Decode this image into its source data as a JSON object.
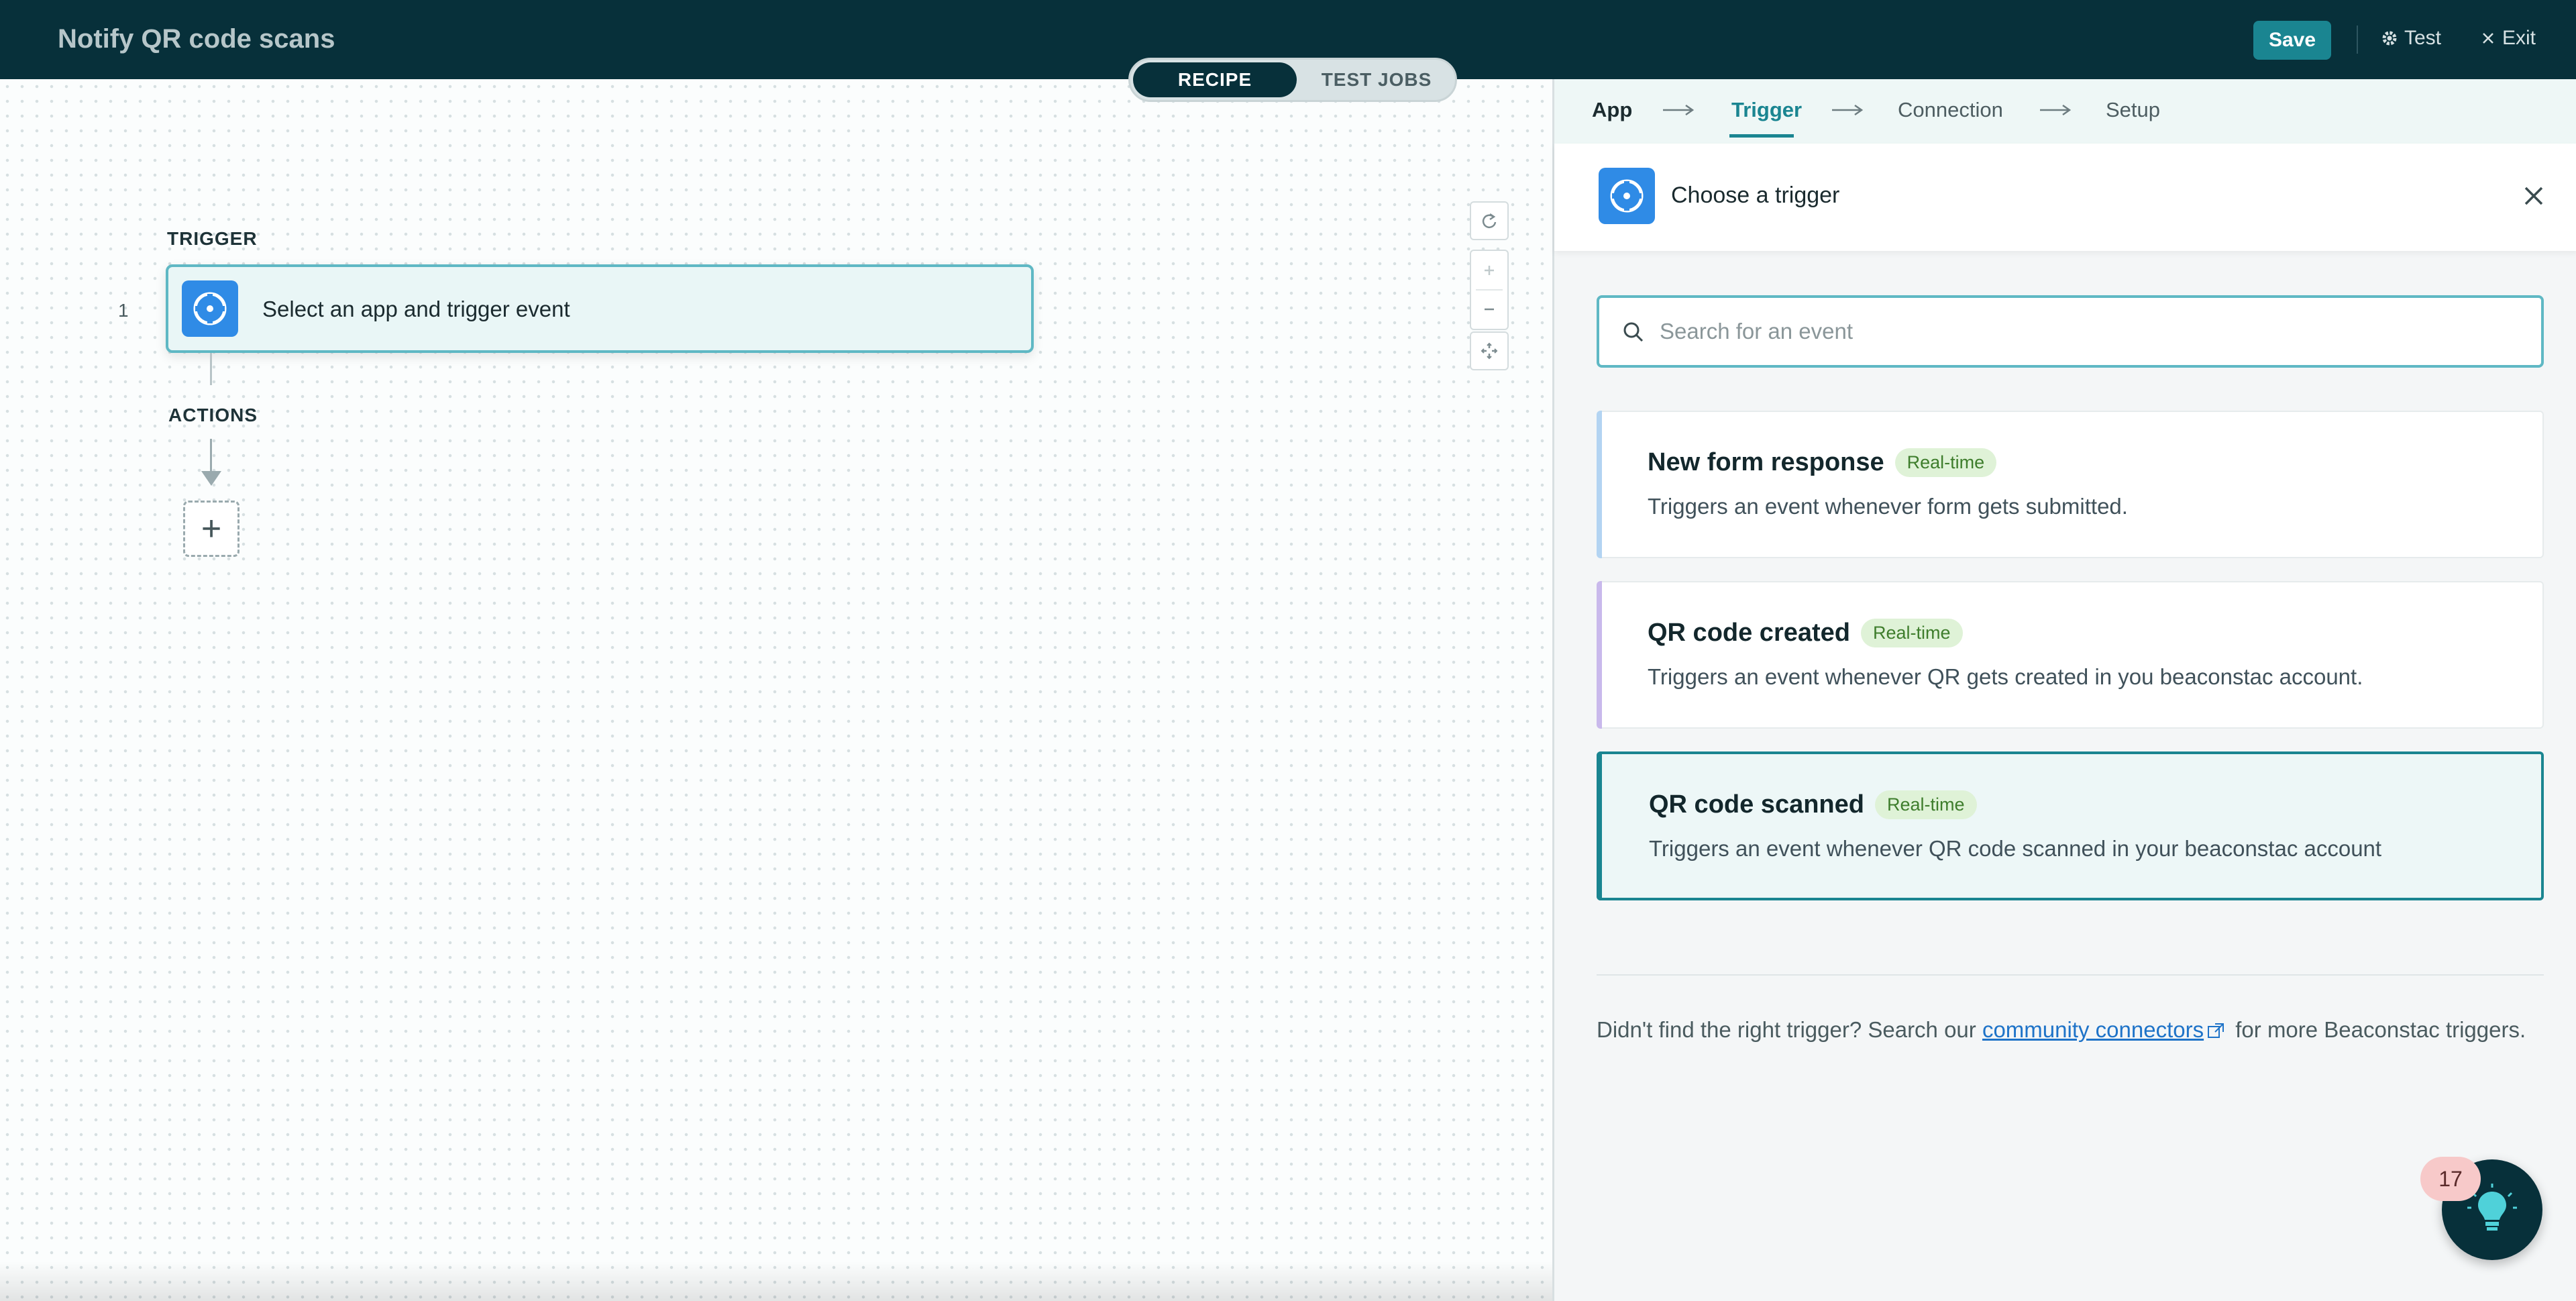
{
  "header": {
    "title": "Notify QR code scans",
    "save_label": "Save",
    "test_label": "Test",
    "exit_label": "Exit"
  },
  "mode_toggle": {
    "options": [
      "RECIPE",
      "TEST JOBS"
    ],
    "selected": "RECIPE"
  },
  "canvas": {
    "trigger_section_label": "TRIGGER",
    "step_number": "1",
    "trigger_placeholder": "Select an app and trigger event",
    "actions_section_label": "ACTIONS",
    "add_step_symbol": "+"
  },
  "steps": {
    "items": [
      "App",
      "Trigger",
      "Connection",
      "Setup"
    ],
    "active": "Trigger"
  },
  "panel": {
    "title": "Choose a trigger",
    "search_placeholder": "Search for an event",
    "events": [
      {
        "title": "New form response",
        "badge": "Real-time",
        "description": "Triggers an event whenever form gets submitted.",
        "accent": "#b3d4f2"
      },
      {
        "title": "QR code created",
        "badge": "Real-time",
        "description": "Triggers an event whenever QR gets created in you beaconstac account.",
        "accent": "#c9b9ec"
      },
      {
        "title": "QR code scanned",
        "badge": "Real-time",
        "description": "Triggers an event whenever QR code scanned in your beaconstac account",
        "accent": "#1a8591"
      }
    ],
    "footnote_prefix": "Didn't find the right trigger? Search our ",
    "footnote_link": "community connectors",
    "footnote_suffix": " for more Beaconstac triggers."
  },
  "help_fab": {
    "badge_count": "17"
  },
  "colors": {
    "header_bg": "#07303a",
    "accent_teal": "#1a8591",
    "app_icon_blue": "#2f8be6",
    "badge_green_bg": "#dff2d7"
  },
  "icons": [
    "gear-icon",
    "close-icon",
    "beaconstac-app-icon",
    "search-icon",
    "external-link-icon",
    "lightbulb-icon",
    "reset-icon",
    "fit-view-icon"
  ]
}
